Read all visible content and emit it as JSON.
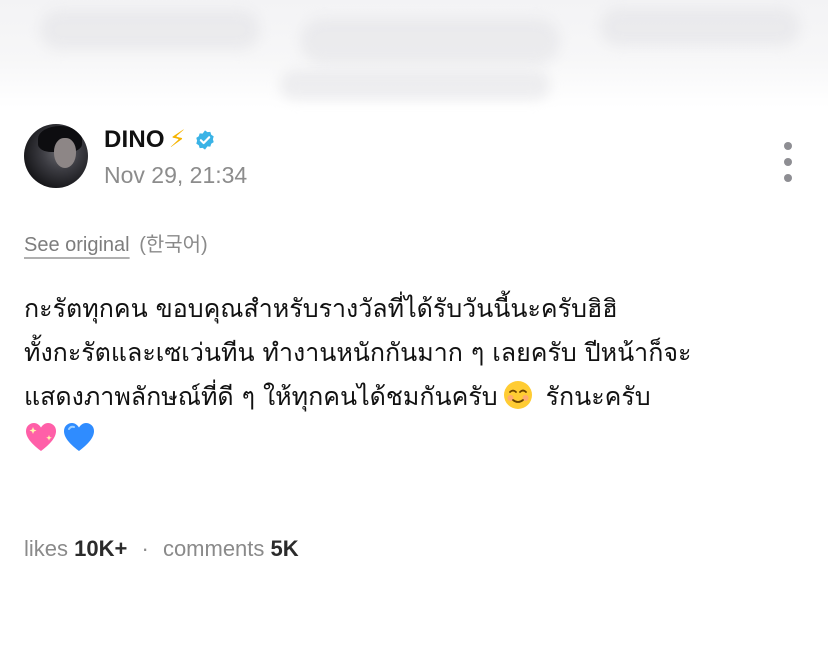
{
  "post": {
    "author": "DINO",
    "author_emoji": "⚡",
    "verified": true,
    "timestamp": "Nov 29, 21:34",
    "translation": {
      "link": "See original",
      "language": "(한국어)"
    },
    "lines": [
      "กะรัตทุกคน ขอบคุณสำหรับรางวัลที่ได้รับวันนี้นะครับฮิฮิ",
      "ทั้งกะรัตและเซเว่นทีน ทำงานหนักกันมาก ๆ เลยครับ ปีหน้าก็จะ",
      "แสดงภาพลักษณ์ที่ดี ๆ ให้ทุกคนได้ชมกันครับ",
      "รักนะครับ"
    ],
    "icons": [
      "smiling-face-icon",
      "sparkling-heart-icon",
      "blue-heart-icon"
    ]
  },
  "stats": {
    "likes_label": "likes",
    "likes_value": "10K+",
    "separator": "·",
    "comments_label": "comments",
    "comments_value": "5K"
  },
  "colors": {
    "bolt": "#f6b400",
    "verified": "#3ab3e6",
    "muted_text": "#8a8a8a",
    "sparkling_heart": "#ff5fa8",
    "blue_heart": "#2f8cff"
  }
}
